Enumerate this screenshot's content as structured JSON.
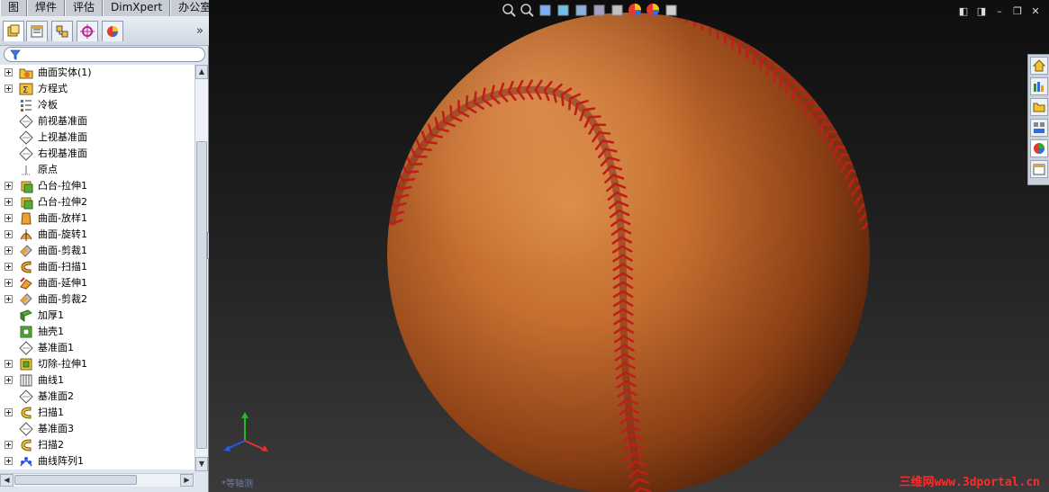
{
  "menu": {
    "tabs": [
      "图",
      "焊件",
      "评估",
      "DimXpert",
      "办公室产品"
    ]
  },
  "feature_panel": {
    "tabs": [
      "feature-manager-icon",
      "property-manager-icon",
      "configuration-manager-icon",
      "dimxpert-manager-icon",
      "display-manager-icon"
    ],
    "expand_label": "»",
    "items": [
      {
        "label": "曲面实体(1)",
        "icon": "surface-bodies-folder-icon",
        "expandable": true
      },
      {
        "label": "方程式",
        "icon": "equations-icon",
        "expandable": true
      },
      {
        "label": "冷板",
        "icon": "material-icon",
        "expandable": false
      },
      {
        "label": "前视基准面",
        "icon": "plane-icon",
        "expandable": false
      },
      {
        "label": "上视基准面",
        "icon": "plane-icon",
        "expandable": false
      },
      {
        "label": "右视基准面",
        "icon": "plane-icon",
        "expandable": false
      },
      {
        "label": "原点",
        "icon": "origin-icon",
        "expandable": false
      },
      {
        "label": "凸台-拉伸1",
        "icon": "boss-extrude-icon",
        "expandable": true
      },
      {
        "label": "凸台-拉伸2",
        "icon": "boss-extrude-icon",
        "expandable": true
      },
      {
        "label": "曲面-放样1",
        "icon": "surface-loft-icon",
        "expandable": true
      },
      {
        "label": "曲面-旋转1",
        "icon": "surface-revolve-icon",
        "expandable": true
      },
      {
        "label": "曲面-剪裁1",
        "icon": "surface-trim-icon",
        "expandable": true
      },
      {
        "label": "曲面-扫描1",
        "icon": "surface-sweep-icon",
        "expandable": true
      },
      {
        "label": "曲面-延伸1",
        "icon": "surface-extend-icon",
        "expandable": true
      },
      {
        "label": "曲面-剪裁2",
        "icon": "surface-trim-icon",
        "expandable": true
      },
      {
        "label": "加厚1",
        "icon": "thicken-icon",
        "expandable": false
      },
      {
        "label": "抽壳1",
        "icon": "shell-icon",
        "expandable": false
      },
      {
        "label": "基准面1",
        "icon": "plane-icon",
        "expandable": false
      },
      {
        "label": "切除-拉伸1",
        "icon": "cut-extrude-icon",
        "expandable": true
      },
      {
        "label": "曲线1",
        "icon": "curve-icon",
        "expandable": true
      },
      {
        "label": "基准面2",
        "icon": "plane-icon",
        "expandable": false
      },
      {
        "label": "扫描1",
        "icon": "sweep-icon",
        "expandable": true
      },
      {
        "label": "基准面3",
        "icon": "plane-icon",
        "expandable": false
      },
      {
        "label": "扫描2",
        "icon": "sweep-icon",
        "expandable": true
      },
      {
        "label": "曲线阵列1",
        "icon": "curve-pattern-icon",
        "expandable": true
      }
    ]
  },
  "viewport": {
    "view_label": "*等轴测",
    "watermark": "三维网www.3dportal.cn",
    "toolbar_icons": [
      "zoom-to-fit-icon",
      "zoom-area-icon",
      "previous-view-icon",
      "section-view-icon",
      "view-orientation-icon",
      "display-style-icon",
      "hide-show-items-icon",
      "edit-appearance-icon",
      "apply-scene-icon",
      "view-settings-icon"
    ],
    "window_buttons": [
      "prev-window-icon",
      "next-window-icon",
      "minimize-icon",
      "restore-icon",
      "close-icon"
    ],
    "taskpane_icons": [
      "home-icon",
      "design-library-icon",
      "file-explorer-icon",
      "view-palette-icon",
      "appearances-icon",
      "custom-properties-icon"
    ],
    "colors": {
      "ball_light": "#d98a45",
      "ball_mid": "#b8652c",
      "ball_dark": "#4a1e08",
      "stitch": "#c01e1e",
      "background_top": "#0e0e0e",
      "background_bottom": "#3a3a3a"
    }
  }
}
